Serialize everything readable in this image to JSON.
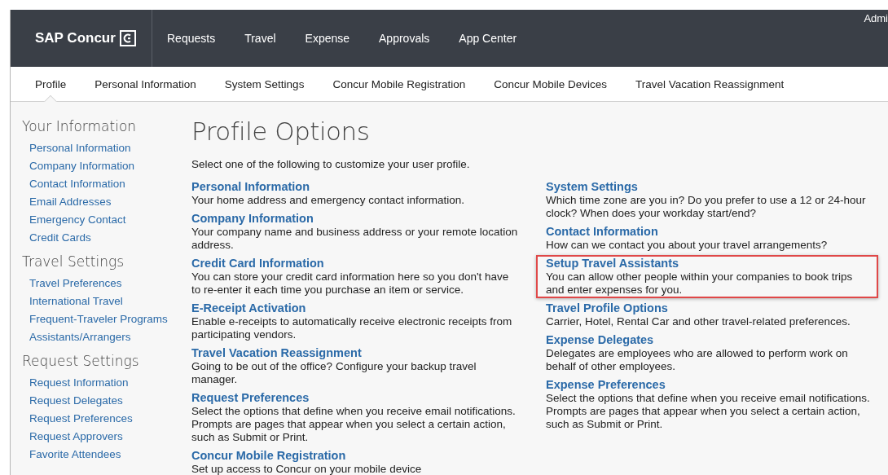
{
  "header": {
    "brand": "SAP Concur",
    "user": "Admi",
    "nav": [
      {
        "label": "Requests"
      },
      {
        "label": "Travel"
      },
      {
        "label": "Expense"
      },
      {
        "label": "Approvals"
      },
      {
        "label": "App Center"
      }
    ]
  },
  "tabs": [
    {
      "label": "Profile",
      "selected": true
    },
    {
      "label": "Personal Information",
      "selected": false
    },
    {
      "label": "System Settings",
      "selected": false
    },
    {
      "label": "Concur Mobile Registration",
      "selected": false
    },
    {
      "label": "Concur Mobile Devices",
      "selected": false
    },
    {
      "label": "Travel Vacation Reassignment",
      "selected": false
    }
  ],
  "sidebar": {
    "sections": [
      {
        "title": "Your Information",
        "items": [
          "Personal Information",
          "Company Information",
          "Contact Information",
          "Email Addresses",
          "Emergency Contact",
          "Credit Cards"
        ]
      },
      {
        "title": "Travel Settings",
        "items": [
          "Travel Preferences",
          "International Travel",
          "Frequent-Traveler Programs",
          "Assistants/Arrangers"
        ]
      },
      {
        "title": "Request Settings",
        "items": [
          "Request Information",
          "Request Delegates",
          "Request Preferences",
          "Request Approvers",
          "Favorite Attendees"
        ]
      }
    ]
  },
  "main": {
    "title": "Profile Options",
    "intro": "Select one of the following to customize your user profile.",
    "columns": [
      [
        {
          "title": "Personal Information",
          "description": "Your home address and emergency contact information.",
          "highlighted": false
        },
        {
          "title": "Company Information",
          "description": "Your company name and business address or your remote location address.",
          "highlighted": false
        },
        {
          "title": "Credit Card Information",
          "description": "You can store your credit card information here so you don't have to re-enter it each time you purchase an item or service.",
          "highlighted": false
        },
        {
          "title": "E-Receipt Activation",
          "description": "Enable e-receipts to automatically receive electronic receipts from participating vendors.",
          "highlighted": false
        },
        {
          "title": "Travel Vacation Reassignment",
          "description": "Going to be out of the office? Configure your backup travel manager.",
          "highlighted": false
        },
        {
          "title": "Request Preferences",
          "description": "Select the options that define when you receive email notifications. Prompts are pages that appear when you select a certain action, such as Submit or Print.",
          "highlighted": false
        },
        {
          "title": "Concur Mobile Registration",
          "description": "Set up access to Concur on your mobile device",
          "highlighted": false
        }
      ],
      [
        {
          "title": "System Settings",
          "description": "Which time zone are you in? Do you prefer to use a 12 or 24-hour clock? When does your workday start/end?",
          "highlighted": false
        },
        {
          "title": "Contact Information",
          "description": "How can we contact you about your travel arrangements?",
          "highlighted": false
        },
        {
          "title": "Setup Travel Assistants",
          "description": "You can allow other people within your companies to book trips and enter expenses for you.",
          "highlighted": true
        },
        {
          "title": "Travel Profile Options",
          "description": "Carrier, Hotel, Rental Car and other travel-related preferences.",
          "highlighted": false
        },
        {
          "title": "Expense Delegates",
          "description": "Delegates are employees who are allowed to perform work on behalf of other employees.",
          "highlighted": false
        },
        {
          "title": "Expense Preferences",
          "description": "Select the options that define when you receive email notifications. Prompts are pages that appear when you select a certain action, such as Submit or Print.",
          "highlighted": false
        }
      ]
    ]
  }
}
